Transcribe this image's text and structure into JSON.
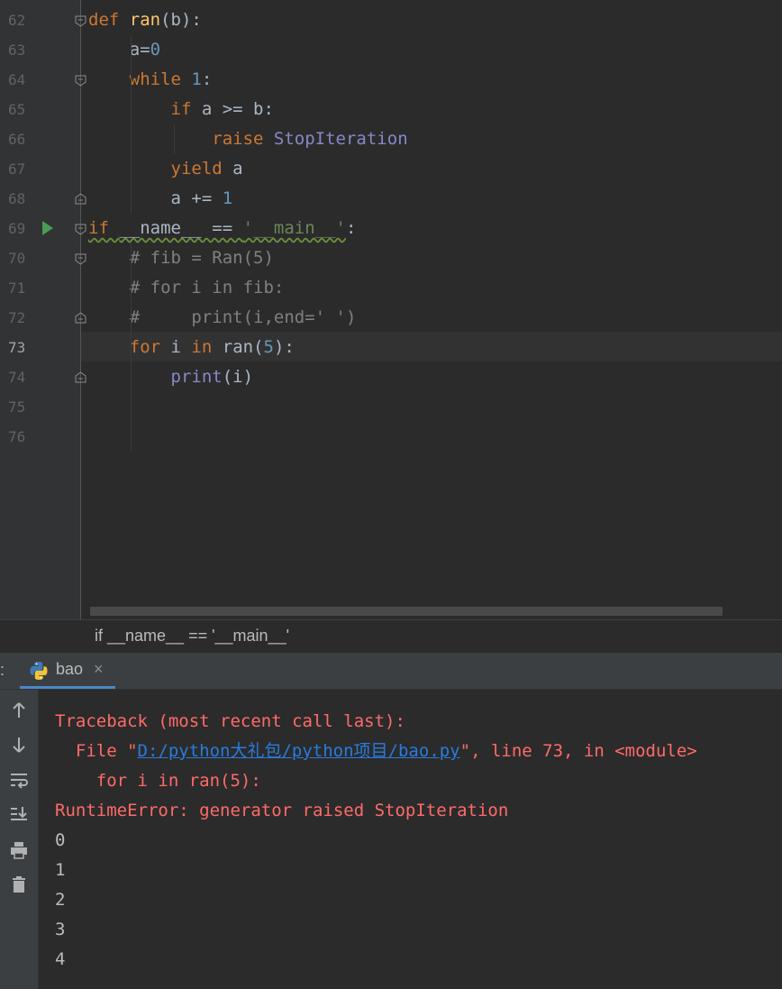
{
  "editor": {
    "lines": [
      {
        "num": "62",
        "parts": [
          {
            "t": "def ",
            "c": "kw"
          },
          {
            "t": "ran",
            "c": "fn"
          },
          {
            "t": "(b):",
            "c": ""
          }
        ]
      },
      {
        "num": "63",
        "parts": [
          {
            "t": "    a=",
            "c": ""
          },
          {
            "t": "0",
            "c": "num"
          }
        ]
      },
      {
        "num": "64",
        "parts": [
          {
            "t": "    ",
            "c": ""
          },
          {
            "t": "while ",
            "c": "kw"
          },
          {
            "t": "1",
            "c": "num"
          },
          {
            "t": ":",
            "c": ""
          }
        ]
      },
      {
        "num": "65",
        "parts": [
          {
            "t": "        ",
            "c": ""
          },
          {
            "t": "if ",
            "c": "kw"
          },
          {
            "t": "a >= b:",
            "c": ""
          }
        ]
      },
      {
        "num": "66",
        "parts": [
          {
            "t": "            ",
            "c": ""
          },
          {
            "t": "raise ",
            "c": "kw"
          },
          {
            "t": "StopIteration",
            "c": "cls"
          }
        ]
      },
      {
        "num": "67",
        "parts": [
          {
            "t": "        ",
            "c": ""
          },
          {
            "t": "yield ",
            "c": "kw"
          },
          {
            "t": "a",
            "c": ""
          }
        ]
      },
      {
        "num": "68",
        "parts": [
          {
            "t": "        a += ",
            "c": ""
          },
          {
            "t": "1",
            "c": "num"
          }
        ]
      },
      {
        "num": "69",
        "parts": [
          {
            "t": "if ",
            "c": "kw warn"
          },
          {
            "t": "__name__ == ",
            "c": "warn"
          },
          {
            "t": "'__main__'",
            "c": "str warn"
          },
          {
            "t": ":",
            "c": ""
          }
        ]
      },
      {
        "num": "70",
        "parts": [
          {
            "t": "    # fib = Ran(5)",
            "c": "cm"
          }
        ]
      },
      {
        "num": "71",
        "parts": [
          {
            "t": "    # for i in fib:",
            "c": "cm"
          }
        ]
      },
      {
        "num": "72",
        "parts": [
          {
            "t": "    #     print(i,end=' ')",
            "c": "cm"
          }
        ]
      },
      {
        "num": "73",
        "parts": [
          {
            "t": "    ",
            "c": ""
          },
          {
            "t": "for ",
            "c": "kw"
          },
          {
            "t": "i ",
            "c": ""
          },
          {
            "t": "in ",
            "c": "kw"
          },
          {
            "t": "ran(",
            "c": ""
          },
          {
            "t": "5",
            "c": "num"
          },
          {
            "t": "):",
            "c": ""
          }
        ]
      },
      {
        "num": "74",
        "parts": [
          {
            "t": "        ",
            "c": ""
          },
          {
            "t": "print",
            "c": "bi"
          },
          {
            "t": "(i)",
            "c": ""
          }
        ]
      },
      {
        "num": "75",
        "parts": []
      },
      {
        "num": "76",
        "parts": []
      }
    ],
    "current_line": "73"
  },
  "breadcrumb": "if __name__ == '__main__'",
  "run_tab": {
    "label": "bao",
    "colon": ":",
    "close": "×",
    "icon": "python-icon"
  },
  "console": {
    "traceback_header": "Traceback (most recent call last):",
    "file_prefix": "  File \"",
    "file_link": "D:/python大礼包/python项目/bao.py",
    "file_suffix": "\", line 73, in <module>",
    "code_line": "    for i in ran(5):",
    "error": "RuntimeError: generator raised StopIteration",
    "outputs": [
      "0",
      "1",
      "2",
      "3",
      "4"
    ]
  },
  "toolbar_icons": [
    "up-arrow-icon",
    "down-arrow-icon",
    "soft-wrap-icon",
    "scroll-to-end-icon",
    "print-icon",
    "trash-icon"
  ],
  "colors": {
    "keyword": "#cc7832",
    "function": "#ffc66d",
    "number": "#6897bb",
    "string": "#6a8759",
    "comment": "#808080",
    "error": "#ff6b68",
    "link": "#287bde"
  }
}
